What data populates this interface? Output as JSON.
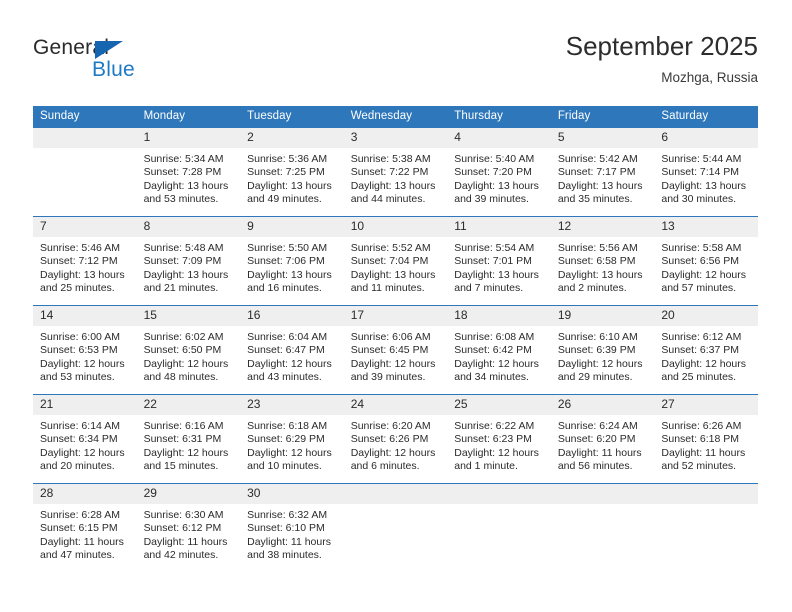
{
  "brand": {
    "name_top": "General",
    "name_bottom": "Blue",
    "triangle_color": "#1565b0",
    "blue_color": "#1f7ac4"
  },
  "header": {
    "title": "September 2025",
    "location": "Mozhga, Russia"
  },
  "theme": {
    "header_blue": "#2e77bb",
    "daynum_band": "#efefef",
    "text": "#2b2b2b"
  },
  "columns": [
    "Sunday",
    "Monday",
    "Tuesday",
    "Wednesday",
    "Thursday",
    "Friday",
    "Saturday"
  ],
  "weeks": [
    [
      {
        "day": "",
        "sunrise": "",
        "sunset": "",
        "daylight": "",
        "empty": true
      },
      {
        "day": "1",
        "sunrise": "Sunrise: 5:34 AM",
        "sunset": "Sunset: 7:28 PM",
        "daylight": "Daylight: 13 hours and 53 minutes."
      },
      {
        "day": "2",
        "sunrise": "Sunrise: 5:36 AM",
        "sunset": "Sunset: 7:25 PM",
        "daylight": "Daylight: 13 hours and 49 minutes."
      },
      {
        "day": "3",
        "sunrise": "Sunrise: 5:38 AM",
        "sunset": "Sunset: 7:22 PM",
        "daylight": "Daylight: 13 hours and 44 minutes."
      },
      {
        "day": "4",
        "sunrise": "Sunrise: 5:40 AM",
        "sunset": "Sunset: 7:20 PM",
        "daylight": "Daylight: 13 hours and 39 minutes."
      },
      {
        "day": "5",
        "sunrise": "Sunrise: 5:42 AM",
        "sunset": "Sunset: 7:17 PM",
        "daylight": "Daylight: 13 hours and 35 minutes."
      },
      {
        "day": "6",
        "sunrise": "Sunrise: 5:44 AM",
        "sunset": "Sunset: 7:14 PM",
        "daylight": "Daylight: 13 hours and 30 minutes."
      }
    ],
    [
      {
        "day": "7",
        "sunrise": "Sunrise: 5:46 AM",
        "sunset": "Sunset: 7:12 PM",
        "daylight": "Daylight: 13 hours and 25 minutes."
      },
      {
        "day": "8",
        "sunrise": "Sunrise: 5:48 AM",
        "sunset": "Sunset: 7:09 PM",
        "daylight": "Daylight: 13 hours and 21 minutes."
      },
      {
        "day": "9",
        "sunrise": "Sunrise: 5:50 AM",
        "sunset": "Sunset: 7:06 PM",
        "daylight": "Daylight: 13 hours and 16 minutes."
      },
      {
        "day": "10",
        "sunrise": "Sunrise: 5:52 AM",
        "sunset": "Sunset: 7:04 PM",
        "daylight": "Daylight: 13 hours and 11 minutes."
      },
      {
        "day": "11",
        "sunrise": "Sunrise: 5:54 AM",
        "sunset": "Sunset: 7:01 PM",
        "daylight": "Daylight: 13 hours and 7 minutes."
      },
      {
        "day": "12",
        "sunrise": "Sunrise: 5:56 AM",
        "sunset": "Sunset: 6:58 PM",
        "daylight": "Daylight: 13 hours and 2 minutes."
      },
      {
        "day": "13",
        "sunrise": "Sunrise: 5:58 AM",
        "sunset": "Sunset: 6:56 PM",
        "daylight": "Daylight: 12 hours and 57 minutes."
      }
    ],
    [
      {
        "day": "14",
        "sunrise": "Sunrise: 6:00 AM",
        "sunset": "Sunset: 6:53 PM",
        "daylight": "Daylight: 12 hours and 53 minutes."
      },
      {
        "day": "15",
        "sunrise": "Sunrise: 6:02 AM",
        "sunset": "Sunset: 6:50 PM",
        "daylight": "Daylight: 12 hours and 48 minutes."
      },
      {
        "day": "16",
        "sunrise": "Sunrise: 6:04 AM",
        "sunset": "Sunset: 6:47 PM",
        "daylight": "Daylight: 12 hours and 43 minutes."
      },
      {
        "day": "17",
        "sunrise": "Sunrise: 6:06 AM",
        "sunset": "Sunset: 6:45 PM",
        "daylight": "Daylight: 12 hours and 39 minutes."
      },
      {
        "day": "18",
        "sunrise": "Sunrise: 6:08 AM",
        "sunset": "Sunset: 6:42 PM",
        "daylight": "Daylight: 12 hours and 34 minutes."
      },
      {
        "day": "19",
        "sunrise": "Sunrise: 6:10 AM",
        "sunset": "Sunset: 6:39 PM",
        "daylight": "Daylight: 12 hours and 29 minutes."
      },
      {
        "day": "20",
        "sunrise": "Sunrise: 6:12 AM",
        "sunset": "Sunset: 6:37 PM",
        "daylight": "Daylight: 12 hours and 25 minutes."
      }
    ],
    [
      {
        "day": "21",
        "sunrise": "Sunrise: 6:14 AM",
        "sunset": "Sunset: 6:34 PM",
        "daylight": "Daylight: 12 hours and 20 minutes."
      },
      {
        "day": "22",
        "sunrise": "Sunrise: 6:16 AM",
        "sunset": "Sunset: 6:31 PM",
        "daylight": "Daylight: 12 hours and 15 minutes."
      },
      {
        "day": "23",
        "sunrise": "Sunrise: 6:18 AM",
        "sunset": "Sunset: 6:29 PM",
        "daylight": "Daylight: 12 hours and 10 minutes."
      },
      {
        "day": "24",
        "sunrise": "Sunrise: 6:20 AM",
        "sunset": "Sunset: 6:26 PM",
        "daylight": "Daylight: 12 hours and 6 minutes."
      },
      {
        "day": "25",
        "sunrise": "Sunrise: 6:22 AM",
        "sunset": "Sunset: 6:23 PM",
        "daylight": "Daylight: 12 hours and 1 minute."
      },
      {
        "day": "26",
        "sunrise": "Sunrise: 6:24 AM",
        "sunset": "Sunset: 6:20 PM",
        "daylight": "Daylight: 11 hours and 56 minutes."
      },
      {
        "day": "27",
        "sunrise": "Sunrise: 6:26 AM",
        "sunset": "Sunset: 6:18 PM",
        "daylight": "Daylight: 11 hours and 52 minutes."
      }
    ],
    [
      {
        "day": "28",
        "sunrise": "Sunrise: 6:28 AM",
        "sunset": "Sunset: 6:15 PM",
        "daylight": "Daylight: 11 hours and 47 minutes."
      },
      {
        "day": "29",
        "sunrise": "Sunrise: 6:30 AM",
        "sunset": "Sunset: 6:12 PM",
        "daylight": "Daylight: 11 hours and 42 minutes."
      },
      {
        "day": "30",
        "sunrise": "Sunrise: 6:32 AM",
        "sunset": "Sunset: 6:10 PM",
        "daylight": "Daylight: 11 hours and 38 minutes."
      },
      {
        "day": "",
        "sunrise": "",
        "sunset": "",
        "daylight": "",
        "empty": true
      },
      {
        "day": "",
        "sunrise": "",
        "sunset": "",
        "daylight": "",
        "empty": true
      },
      {
        "day": "",
        "sunrise": "",
        "sunset": "",
        "daylight": "",
        "empty": true
      },
      {
        "day": "",
        "sunrise": "",
        "sunset": "",
        "daylight": "",
        "empty": true
      }
    ]
  ]
}
